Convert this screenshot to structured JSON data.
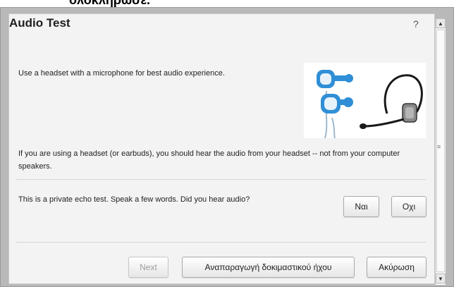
{
  "document": {
    "heading": "ολοκλήρωσε."
  },
  "dialog": {
    "title": "Audio Test",
    "help": "?",
    "intro": "Use a headset with a microphone for best audio experience.",
    "instruction": "If you are using a headset (or earbuds), you should hear the audio from your headset -- not from your computer speakers.",
    "question": "This is a private echo test.  Speak a few words.  Did you hear audio?",
    "yes_label": "Ναι",
    "no_label": "Οχι",
    "next_label": "Next",
    "play_label": "Αναπαραγωγή δοκιμαστικού ήχου",
    "cancel_label": "Ακύρωση"
  },
  "icons": {
    "help": "question-mark-icon",
    "scroll_up": "arrow-up-icon",
    "scroll_down": "arrow-down-icon"
  },
  "colors": {
    "accent_blue": "#2f8fd6",
    "panel_bg": "#f3f3f3"
  }
}
